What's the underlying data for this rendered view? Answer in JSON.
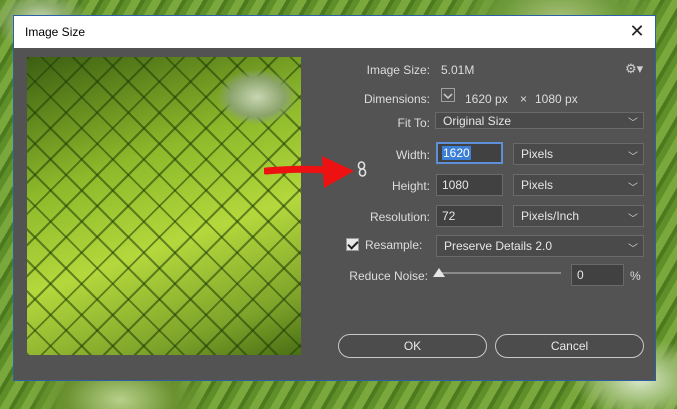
{
  "window": {
    "title": "Image Size"
  },
  "info": {
    "image_size_label": "Image Size:",
    "image_size_value": "5.01M",
    "dimensions_label": "Dimensions:",
    "dimensions_width": "1620 px",
    "dimensions_sep": "×",
    "dimensions_height": "1080 px"
  },
  "fit_to": {
    "label": "Fit To:",
    "value": "Original Size"
  },
  "width": {
    "label": "Width:",
    "value": "1620",
    "unit": "Pixels"
  },
  "height": {
    "label": "Height:",
    "value": "1080",
    "unit": "Pixels"
  },
  "resolution": {
    "label": "Resolution:",
    "value": "72",
    "unit": "Pixels/Inch"
  },
  "resample": {
    "label": "Resample:",
    "checked": true,
    "value": "Preserve Details 2.0"
  },
  "reduce_noise": {
    "label": "Reduce Noise:",
    "value": "0",
    "unit": "%",
    "level": 0
  },
  "buttons": {
    "ok": "OK",
    "cancel": "Cancel"
  },
  "icons": {
    "close": "close-icon",
    "gear": "gear-icon",
    "link": "link-icon",
    "arrow": "red-arrow-annotation"
  },
  "colors": {
    "dialog_bg": "#535353",
    "accent": "#3c7fd6",
    "arrow": "#ee1111"
  }
}
